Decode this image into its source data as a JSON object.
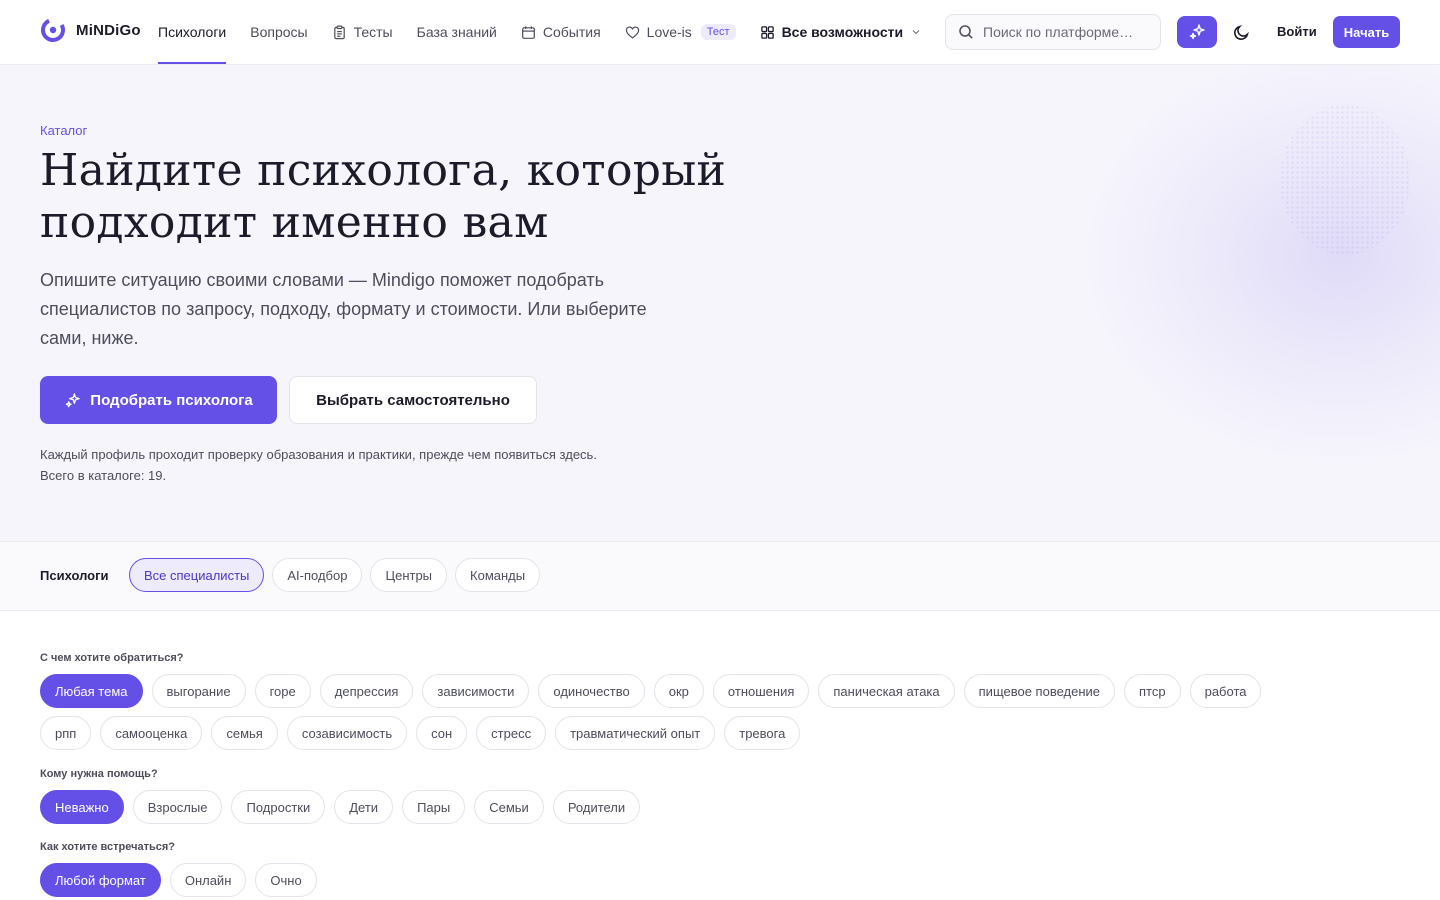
{
  "header": {
    "logo_text": "MiNDiGo",
    "nav": [
      {
        "label": "Психологи",
        "icon": "",
        "active": true
      },
      {
        "label": "Вопросы",
        "icon": ""
      },
      {
        "label": "Тесты",
        "icon": "clipboard-icon"
      },
      {
        "label": "База знаний",
        "icon": ""
      },
      {
        "label": "События",
        "icon": "calendar-icon"
      },
      {
        "label": "Love-is",
        "icon": "heart-icon",
        "badge": "Тест"
      },
      {
        "label": "Все возможности",
        "icon": "grid-icon",
        "chevron": "chevron-down-icon"
      }
    ],
    "search_placeholder": "Поиск по платформе…",
    "ai_button_icon": "sparkles-icon",
    "theme_icon": "moon-icon",
    "login_label": "Войти",
    "start_label": "Начать"
  },
  "hero": {
    "eyebrow": "Каталог",
    "title": "Найдите психолога, который подходит именно вам",
    "subtitle": "Опишите ситуацию своими словами — Mindigo поможет подобрать специалистов по запросу, подходу, формату и стоимости. Или выберите сами, ниже.",
    "primary_button": "Подобрать психолога",
    "secondary_button": "Выбрать самостоятельно",
    "note_line1": "Каждый профиль проходит проверку образования и практики, прежде чем появиться здесь.",
    "note_line2": "Всего в каталоге: 19."
  },
  "catalog_tabs": {
    "label": "Психологи",
    "items": [
      "Все специалисты",
      "AI-подбор",
      "Центры",
      "Команды"
    ],
    "active_index": 0
  },
  "filters": {
    "topic": {
      "label": "С чем хотите обратиться?",
      "row1": [
        "Любая тема",
        "выгорание",
        "горе",
        "депрессия",
        "зависимости",
        "одиночество",
        "окр",
        "отношения",
        "паническая атака",
        "пищевое поведение",
        "птср",
        "работа"
      ],
      "row2": [
        "рпп",
        "самооценка",
        "семья",
        "созависимость",
        "сон",
        "стресс",
        "травматический опыт",
        "тревога"
      ],
      "selected": "Любая тема"
    },
    "audience": {
      "label": "Кому нужна помощь?",
      "options": [
        "Неважно",
        "Взрослые",
        "Подростки",
        "Дети",
        "Пары",
        "Семьи",
        "Родители"
      ],
      "selected": "Неважно"
    },
    "format": {
      "label": "Как хотите встречаться?",
      "options": [
        "Любой формат",
        "Онлайн",
        "Очно"
      ],
      "selected": "Любой формат"
    }
  },
  "colors": {
    "accent": "#6450e6",
    "accent_soft": "#eeebfc",
    "hero_bg": "#f6f5fc",
    "text": "#1c1b29",
    "muted": "#4d4d5c",
    "border": "#e3e3ea"
  }
}
